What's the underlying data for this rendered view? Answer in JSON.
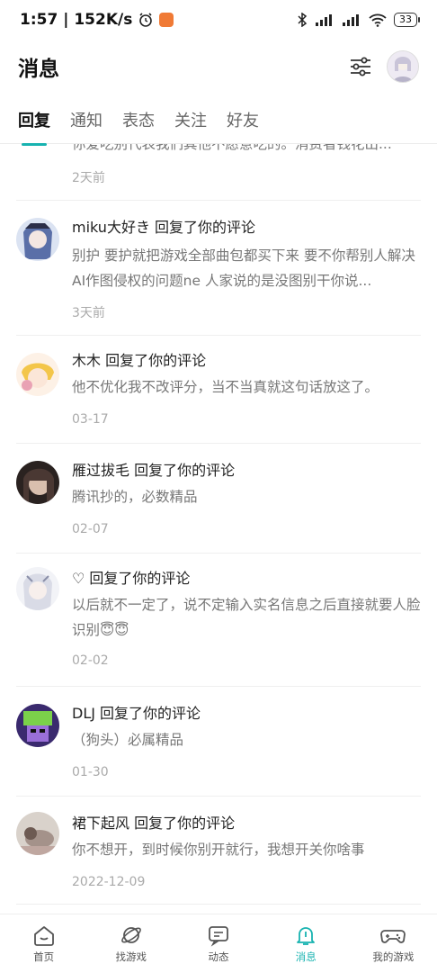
{
  "status_bar": {
    "time_speed": "1:57 | 152K/s",
    "battery": "33"
  },
  "header": {
    "title": "消息"
  },
  "tabs": [
    {
      "label": "回复",
      "active": true
    },
    {
      "label": "通知"
    },
    {
      "label": "表态"
    },
    {
      "label": "关注"
    },
    {
      "label": "好友"
    }
  ],
  "messages": [
    {
      "name_line": "",
      "text": "你爱吃别代表我们其他不愿意吃的。消费者钱花出...",
      "date": "2天前"
    },
    {
      "name_line": "miku大好き 回复了你的评论",
      "text": "别护 要护就把游戏全部曲包都买下来 要不你帮别人解决AI作图侵权的问题ne 人家说的是没图别干你说...",
      "date": "3天前"
    },
    {
      "name_line": "木木 回复了你的评论",
      "text": "他不优化我不改评分，当不当真就这句话放这了。",
      "date": "03-17"
    },
    {
      "name_line": "雁过拔毛 回复了你的评论",
      "text": "腾讯抄的，必数精品",
      "date": "02-07"
    },
    {
      "name_line": "♡ 回复了你的评论",
      "text": "以后就不一定了，说不定输入实名信息之后直接就要人脸识别😇😇",
      "date": "02-02"
    },
    {
      "name_line": "DLJ 回复了你的评论",
      "text": "（狗头）必属精品",
      "date": "01-30"
    },
    {
      "name_line": "裙下起风 回复了你的评论",
      "text": "你不想开，到时候你别开就行，我想开关你啥事",
      "date": "2022-12-09"
    }
  ],
  "bottom_nav": [
    {
      "label": "首页",
      "icon": "home-icon"
    },
    {
      "label": "找游戏",
      "icon": "planet-icon"
    },
    {
      "label": "动态",
      "icon": "chat-icon"
    },
    {
      "label": "消息",
      "icon": "bell-icon",
      "active": true
    },
    {
      "label": "我的游戏",
      "icon": "gamepad-icon"
    }
  ],
  "colors": {
    "accent": "#17b3b0"
  }
}
